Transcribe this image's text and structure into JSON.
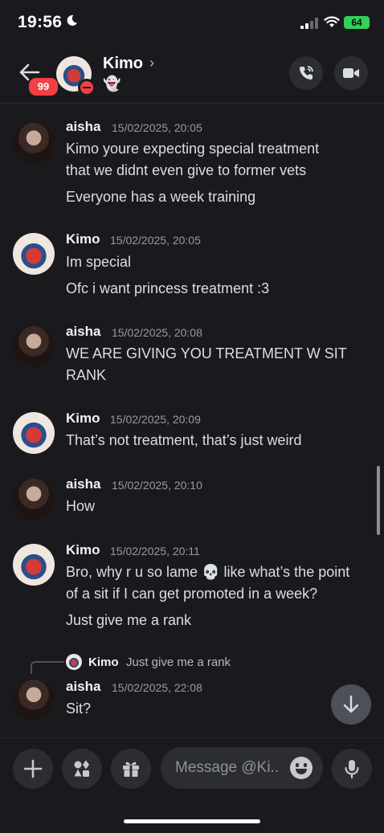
{
  "status": {
    "time": "19:56",
    "battery": "64"
  },
  "header": {
    "back_badge": "99",
    "name": "Kimo",
    "chevron": "›",
    "status_emoji": "👻"
  },
  "messages": [
    {
      "author": "aisha",
      "timestamp": "15/02/2025, 20:05",
      "lines": [
        "Kimo youre expecting special treatment",
        "that we didnt even give to former vets",
        "Everyone has a week training"
      ]
    },
    {
      "author": "Kimo",
      "timestamp": "15/02/2025, 20:05",
      "lines": [
        "Im special",
        "Ofc i want princess treatment :3"
      ]
    },
    {
      "author": "aisha",
      "timestamp": "15/02/2025, 20:08",
      "lines": [
        "WE ARE GIVING YOU TREATMENT W SIT",
        "RANK"
      ]
    },
    {
      "author": "Kimo",
      "timestamp": "15/02/2025, 20:09",
      "lines": [
        "That’s not treatment, that’s just weird"
      ]
    },
    {
      "author": "aisha",
      "timestamp": "15/02/2025, 20:10",
      "lines": [
        "How"
      ]
    },
    {
      "author": "Kimo",
      "timestamp": "15/02/2025, 20:11",
      "lines": [
        "Bro, why r u so lame 💀 like what’s the point",
        "of a sit if I can get promoted in a week?",
        "Just give me a rank"
      ]
    },
    {
      "author": "aisha",
      "timestamp": "15/02/2025, 22:08",
      "reply": {
        "author": "Kimo",
        "text": "Just give me a rank"
      },
      "lines": [
        "Sit?"
      ]
    }
  ],
  "composer": {
    "placeholder": "Message @Ki..."
  }
}
